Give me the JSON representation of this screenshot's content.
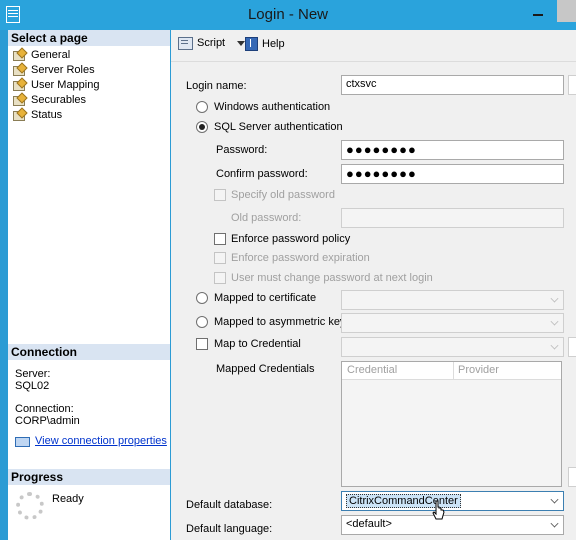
{
  "window": {
    "title": "Login - New"
  },
  "left": {
    "select_page_header": "Select a page",
    "pages": [
      "General",
      "Server Roles",
      "User Mapping",
      "Securables",
      "Status"
    ],
    "connection_header": "Connection",
    "server_label": "Server:",
    "server_value": "SQL02",
    "connection_label": "Connection:",
    "connection_value": "CORP\\admin",
    "view_props_link": "View connection properties",
    "progress_header": "Progress",
    "progress_status": "Ready"
  },
  "toolbar": {
    "script_label": "Script",
    "help_label": "Help"
  },
  "form": {
    "login_name_label": "Login name:",
    "login_name_value": "ctxsvc",
    "windows_auth_label": "Windows authentication",
    "sql_auth_label": "SQL Server authentication",
    "password_label": "Password:",
    "password_value": "●●●●●●●●",
    "confirm_password_label": "Confirm password:",
    "confirm_password_value": "●●●●●●●●",
    "specify_old_password_label": "Specify old password",
    "old_password_label": "Old password:",
    "enforce_policy_label": "Enforce password policy",
    "enforce_expiration_label": "Enforce password expiration",
    "must_change_label": "User must change password at next login",
    "mapped_cert_label": "Mapped to certificate",
    "mapped_asym_label": "Mapped to asymmetric key",
    "map_credential_label": "Map to Credential",
    "mapped_credentials_label": "Mapped Credentials",
    "grid_col_credential": "Credential",
    "grid_col_provider": "Provider",
    "default_db_label": "Default database:",
    "default_db_value": "CitrixCommandCenter",
    "default_lang_label": "Default language:",
    "default_lang_value": "<default>"
  }
}
